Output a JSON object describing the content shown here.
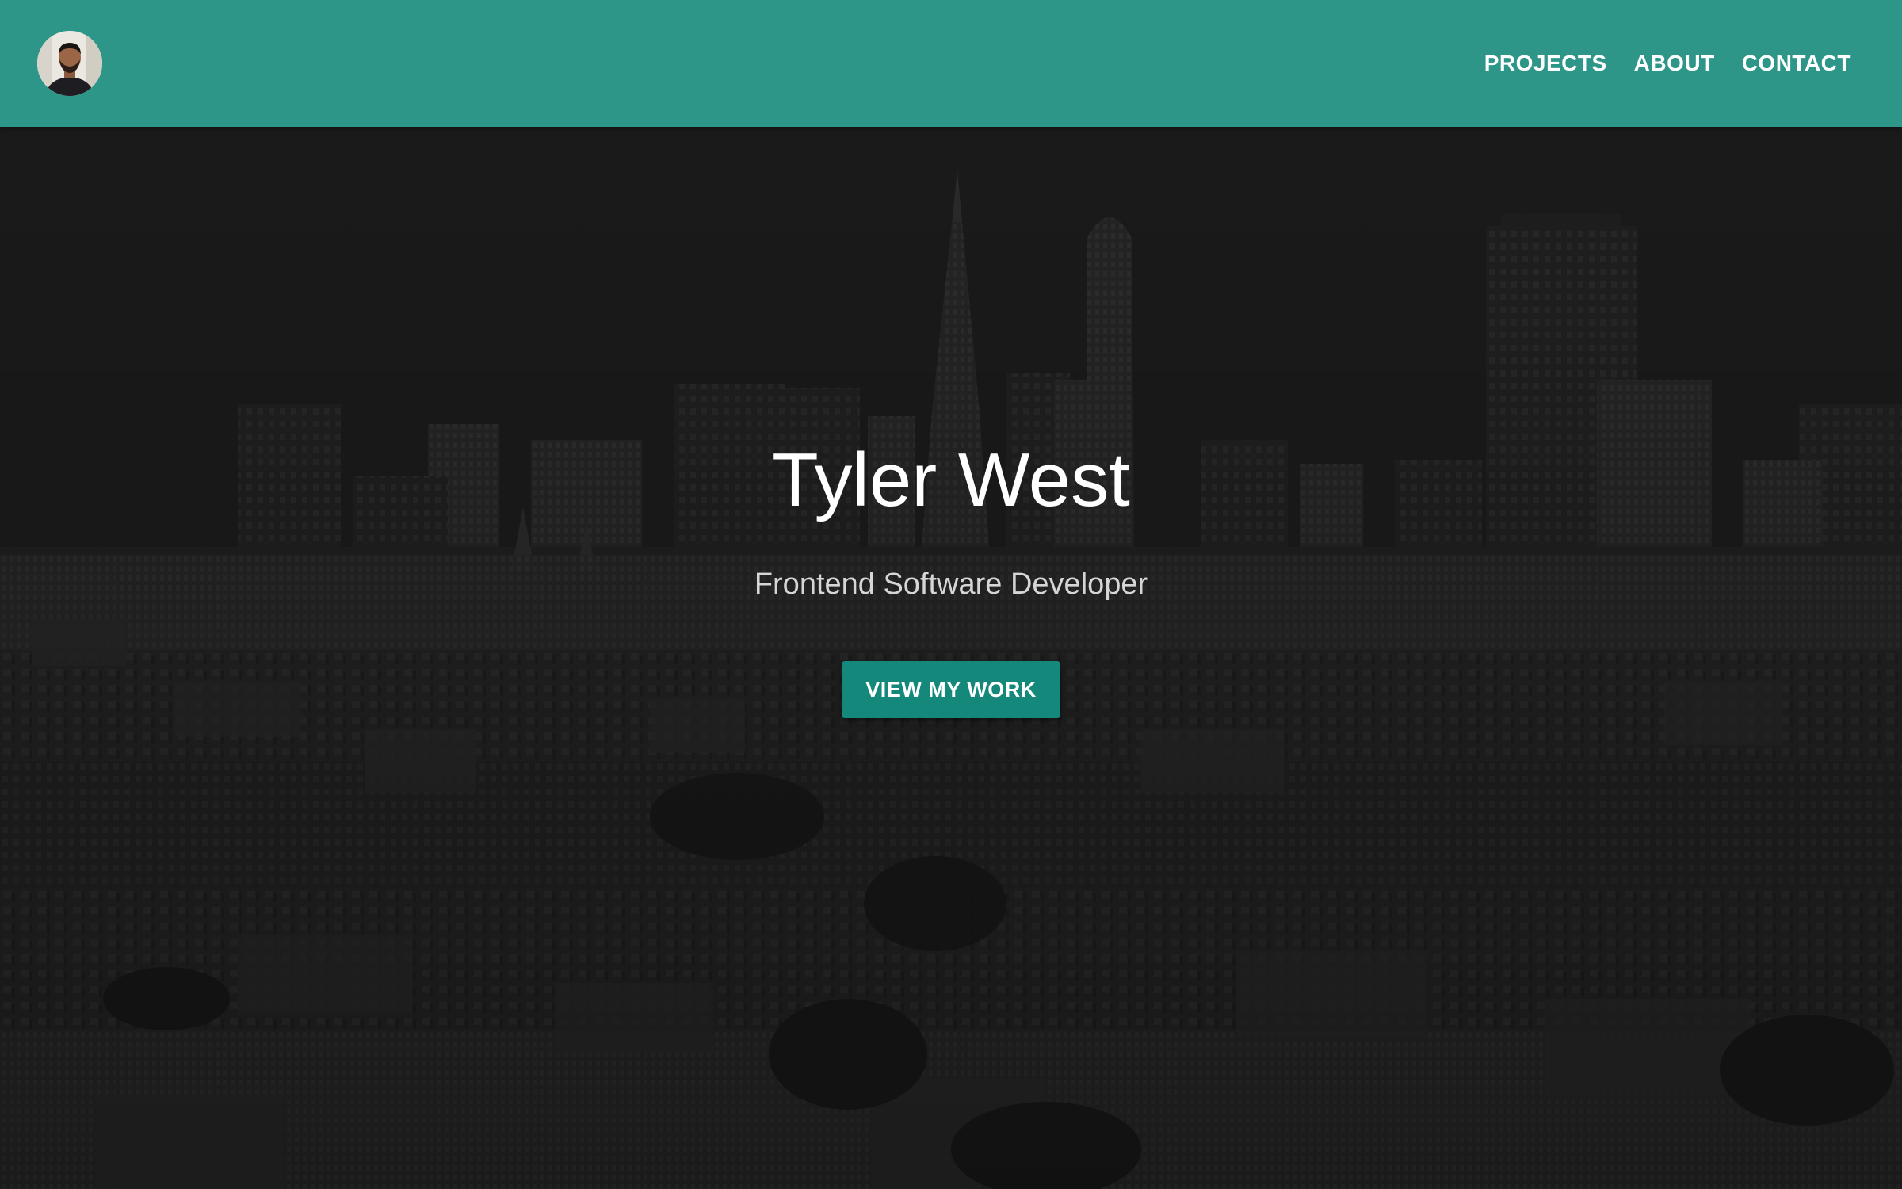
{
  "header": {
    "avatar_icon": "profile-photo",
    "nav": [
      {
        "label": "PROJECTS"
      },
      {
        "label": "ABOUT"
      },
      {
        "label": "CONTACT"
      }
    ]
  },
  "hero": {
    "title": "Tyler West",
    "subtitle": "Frontend Software Developer",
    "cta_label": "VIEW MY WORK",
    "background_icon": "city-skyline-photo"
  },
  "colors": {
    "navbar": "#2e9688",
    "button": "#14897b",
    "hero_bg": "#252525",
    "text_light": "#ffffff"
  }
}
